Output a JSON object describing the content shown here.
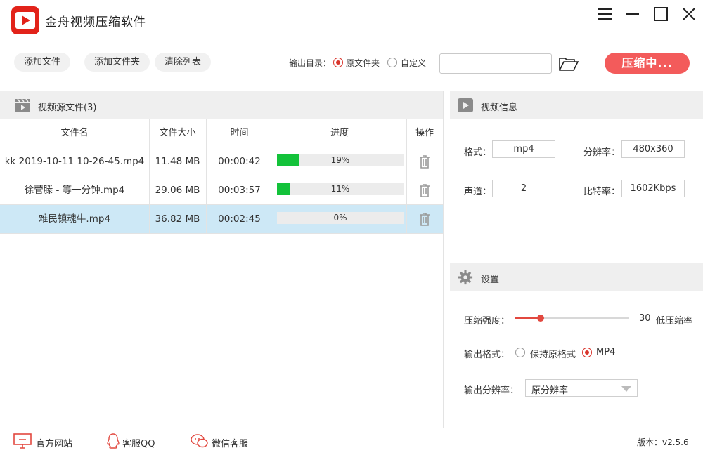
{
  "app": {
    "title": "金舟视频压缩软件"
  },
  "toolbar": {
    "add_file": "添加文件",
    "add_folder": "添加文件夹",
    "clear_list": "清除列表",
    "output_dir_label": "输出目录：",
    "option_original": "原文件夹",
    "option_custom": "自定义",
    "path_value": "",
    "compress_button": "压缩中..."
  },
  "source": {
    "title": "视频源文件(3)",
    "columns": [
      "文件名",
      "文件大小",
      "时间",
      "进度",
      "操作"
    ],
    "rows": [
      {
        "name": "kk 2019-10-11 10-26-45.mp4",
        "size": "11.48 MB",
        "time": "00:00:42",
        "progress_text": "19%",
        "progress": 19
      },
      {
        "name": "徐菅滕 - 等一分钟.mp4",
        "size": "29.06 MB",
        "time": "00:03:57",
        "progress_text": "11%",
        "progress": 11
      },
      {
        "name": "难民镇魂牛.mp4",
        "size": "36.82 MB",
        "time": "00:02:45",
        "progress_text": "0%",
        "progress": 0
      }
    ]
  },
  "info": {
    "title": "视频信息",
    "format_label": "格式：",
    "format_value": "mp4",
    "resolution_label": "分辨率：",
    "resolution_value": "480x360",
    "channel_label": "声道：",
    "channel_value": "2",
    "bitrate_label": "比特率：",
    "bitrate_value": "1602Kbps"
  },
  "settings": {
    "title": "设置",
    "strength_label": "压缩强度：",
    "strength_value": "30",
    "strength_level": 30,
    "strength_hint": "低压缩率",
    "format_label": "输出格式：",
    "format_keep": "保持原格式",
    "format_mp4": "MP4",
    "resolution_label": "输出分辨率：",
    "resolution_value": "原分辨率"
  },
  "footer": {
    "website": "官方网站",
    "qq": "客服QQ",
    "wechat": "微信客服",
    "version": "版本：v2.5.6"
  },
  "colors": {
    "accent": "#e2231a",
    "button": "#f35b5b",
    "progress": "#13c23a",
    "selected_row": "#cde8f6"
  }
}
